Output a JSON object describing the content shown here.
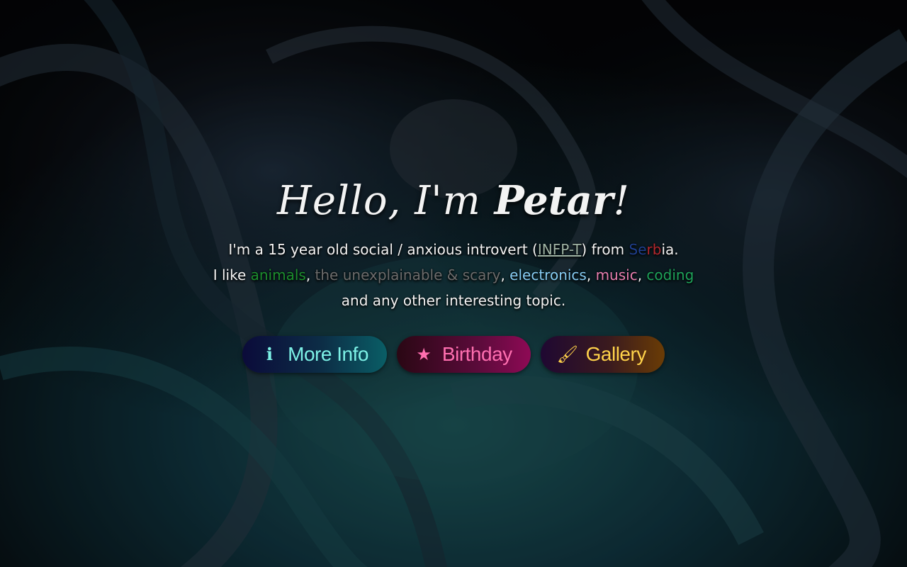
{
  "background": {
    "description_icon": "anime-character-backdrop",
    "tint_color": "#0a2a33"
  },
  "headline": {
    "greeting": "Hello, I'm ",
    "name": "Petar",
    "punct": "!"
  },
  "bio": {
    "line1_prefix": "I'm a 15 year old social / anxious introvert (",
    "mbti": "INFP-T",
    "line1_mid": ") from ",
    "country_s": "S",
    "country_e": "e",
    "country_r": "r",
    "country_b": "b",
    "country_rest": "ia",
    "line1_end": ".",
    "line2_prefix": "I like ",
    "topic_animals": "animals",
    "sep1": ", ",
    "topic_scary": "the unexplainable & scary",
    "sep2": ", ",
    "topic_electronics": "electronics",
    "sep3": ", ",
    "topic_music": "music",
    "sep4": ", ",
    "topic_coding": "coding",
    "line3": "and any other interesting topic."
  },
  "buttons": {
    "info": {
      "label": "More Info",
      "icon": "info-icon",
      "icon_glyph": "ℹ"
    },
    "birthday": {
      "label": "Birthday",
      "icon": "star-icon",
      "icon_glyph": "★"
    },
    "gallery": {
      "label": "Gallery",
      "icon": "paintbrush-icon",
      "icon_glyph": "🖌"
    }
  }
}
